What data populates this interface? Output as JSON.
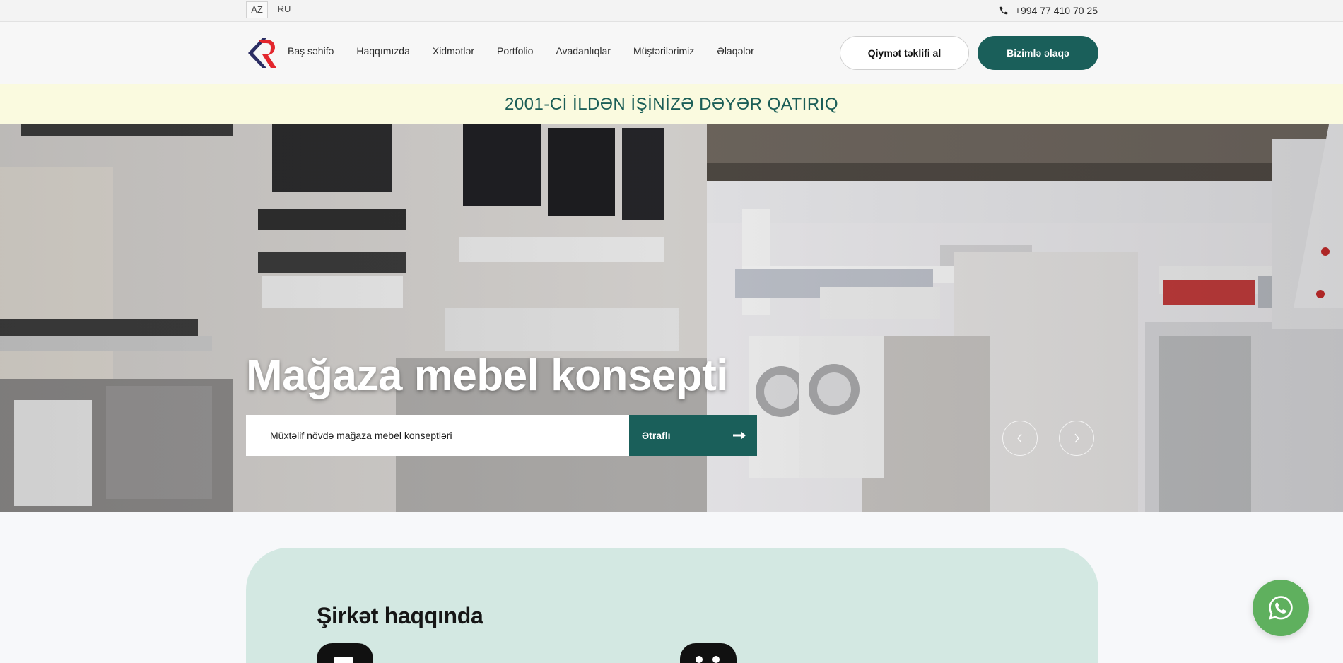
{
  "topbar": {
    "languages": [
      "AZ",
      "RU"
    ],
    "active_language": "AZ",
    "phone": "+994 77 410 70 25",
    "phone_icon": "phone-icon"
  },
  "header": {
    "logo_icon": "company-logo",
    "nav": [
      "Baş səhifə",
      "Haqqımızda",
      "Xidmətlər",
      "Portfolio",
      "Avadanlıqlar",
      "Müştərilərimiz",
      "Əlaqələr"
    ],
    "quote_button": "Qiymət təklifi al",
    "contact_button": "Bizimlə əlaqə"
  },
  "tagline": "2001-Cİ İLDƏN İŞİNİZƏ DƏYƏR QATIRIQ",
  "hero": {
    "title": "Mağaza mebel konsepti",
    "description": "Müxtəlif növdə mağaza mebel konseptləri",
    "more_button": "Ətraflı",
    "arrow_icon": "arrow-right-icon",
    "prev_icon": "chevron-left-icon",
    "next_icon": "chevron-right-icon"
  },
  "about": {
    "title": "Şirkət haqqında"
  },
  "floating": {
    "whatsapp_icon": "whatsapp-icon"
  },
  "colors": {
    "brand": "#1a5f5a",
    "tagline_bg": "#fafadf",
    "about_bg": "#d3e8e2",
    "whatsapp": "#5fb05e",
    "logo_red": "#e3262d",
    "logo_navy": "#2b2d63"
  }
}
